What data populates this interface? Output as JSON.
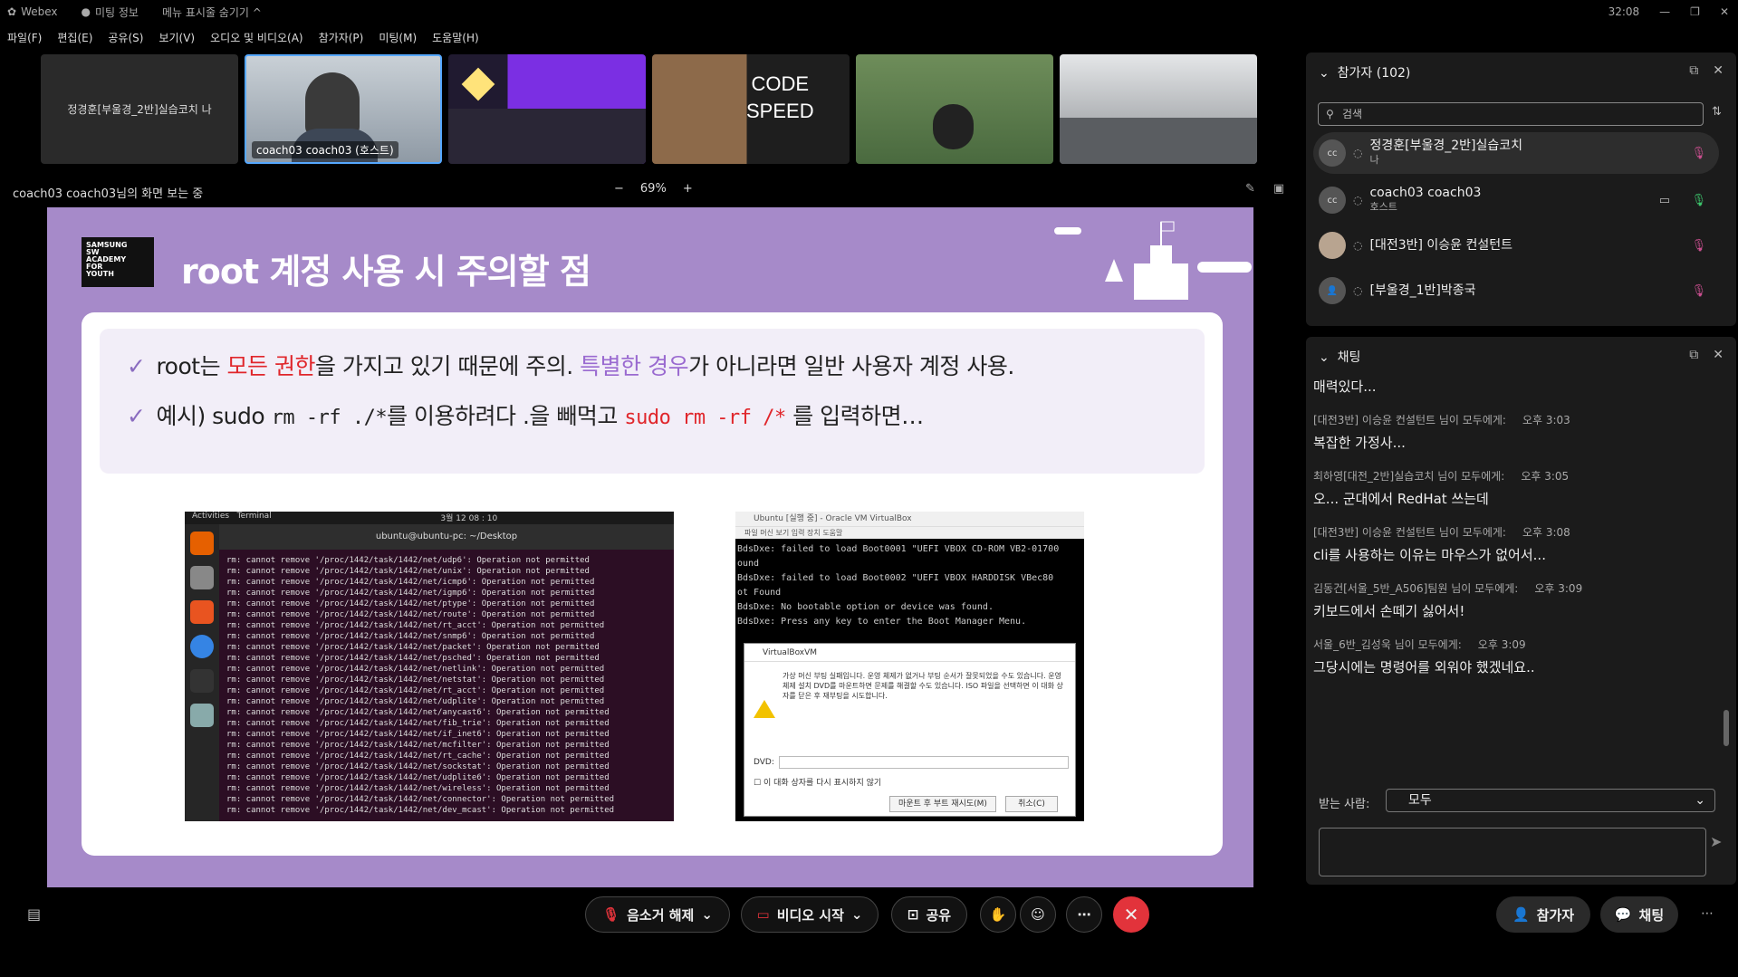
{
  "titlebar": {
    "app": "Webex",
    "meeting_info": "미팅 정보",
    "hide_menu": "메뉴 표시줄 숨기기 ^",
    "time": "32:08"
  },
  "menu": [
    "파일(F)",
    "편집(E)",
    "공유(S)",
    "보기(V)",
    "오디오 및 비디오(A)",
    "참가자(P)",
    "미팅(M)",
    "도움말(H)"
  ],
  "thumbs": {
    "name_tile": "정경훈[부울경_2반]실습코치 나",
    "host_label": "coach03 coach03 (호스트)",
    "code_speed_line1": "CODE",
    "code_speed_line2": "SPEED"
  },
  "share": {
    "viewing": "coach03 coach03님의 화면 보는 중",
    "zoom": "69%",
    "minus": "−",
    "plus": "+"
  },
  "slide": {
    "logo": "SAMSUNG SW ACADEMY FOR YOUTH",
    "title": "root 계정 사용 시 주의할 점",
    "b1_a": "root는 ",
    "b1_red": "모든 권한",
    "b1_b": "을 가지고 있기 때문에 주의. ",
    "b1_purple": "특별한 경우",
    "b1_c": "가 아니라면 일반 사용자 계정 사용.",
    "b2_a": "예시) sudo ",
    "b2_mono1": "rm -rf ./*",
    "b2_b": "를 이용하려다 .을 빼먹고 ",
    "b2_red": "sudo rm -rf /*",
    "b2_c": " 를 입력하면…",
    "term_activities": "Activities",
    "term_app": "Terminal",
    "term_clock": "3월 12 08 : 10",
    "term_title": "ubuntu@ubuntu-pc: ~/Desktop",
    "term_lines": [
      "rm: cannot remove '/proc/1442/task/1442/net/udp6': Operation not permitted",
      "rm: cannot remove '/proc/1442/task/1442/net/unix': Operation not permitted",
      "rm: cannot remove '/proc/1442/task/1442/net/icmp6': Operation not permitted",
      "rm: cannot remove '/proc/1442/task/1442/net/igmp6': Operation not permitted",
      "rm: cannot remove '/proc/1442/task/1442/net/ptype': Operation not permitted",
      "rm: cannot remove '/proc/1442/task/1442/net/route': Operation not permitted",
      "rm: cannot remove '/proc/1442/task/1442/net/rt_acct': Operation not permitted",
      "rm: cannot remove '/proc/1442/task/1442/net/snmp6': Operation not permitted",
      "rm: cannot remove '/proc/1442/task/1442/net/packet': Operation not permitted",
      "rm: cannot remove '/proc/1442/task/1442/net/psched': Operation not permitted",
      "rm: cannot remove '/proc/1442/task/1442/net/netlink': Operation not permitted",
      "rm: cannot remove '/proc/1442/task/1442/net/netstat': Operation not permitted",
      "rm: cannot remove '/proc/1442/task/1442/net/rt_acct': Operation not permitted",
      "rm: cannot remove '/proc/1442/task/1442/net/udplite': Operation not permitted",
      "rm: cannot remove '/proc/1442/task/1442/net/anycast6': Operation not permitted",
      "rm: cannot remove '/proc/1442/task/1442/net/fib_trie': Operation not permitted",
      "rm: cannot remove '/proc/1442/task/1442/net/if_inet6': Operation not permitted",
      "rm: cannot remove '/proc/1442/task/1442/net/mcfilter': Operation not permitted",
      "rm: cannot remove '/proc/1442/task/1442/net/rt_cache': Operation not permitted",
      "rm: cannot remove '/proc/1442/task/1442/net/sockstat': Operation not permitted",
      "rm: cannot remove '/proc/1442/task/1442/net/udplite6': Operation not permitted",
      "rm: cannot remove '/proc/1442/task/1442/net/wireless': Operation not permitted",
      "rm: cannot remove '/proc/1442/task/1442/net/connector': Operation not permitted",
      "rm: cannot remove '/proc/1442/task/1442/net/dev_mcast': Operation not permitted"
    ],
    "vbox_title": "Ubuntu [실행 중] - Oracle VM VirtualBox",
    "vbox_menu": "파일  머신  보기  입력  장치  도움말",
    "vbox_boot": [
      "BdsDxe: failed to load Boot0001 \"UEFI VBOX CD-ROM VB2-01700",
      "ound",
      "BdsDxe: failed to load Boot0002 \"UEFI VBOX HARDDISK VBec80",
      "ot Found",
      "BdsDxe: No bootable option or device was found.",
      "BdsDxe: Press any key to enter the Boot Manager Menu."
    ],
    "dialog_title": "VirtualBoxVM",
    "dialog_msg": "가상 머신 부팅 실패입니다. 운영 체제가 없거나 부팅 순서가 잘못되었을 수도 있습니다. 운영 체제 설치 DVD를 마운트하면 문제를 해결할 수도 있습니다. ISO 파일을 선택하면 이 대화 상자를 닫은 후 재부팅을 시도합니다.",
    "dialog_dvd": "DVD:",
    "dialog_dont_show": "이 대화 상자를 다시 표시하지 않기",
    "dialog_mount": "마운트 후 부트 재시도(M)",
    "dialog_cancel": "취소(C)"
  },
  "participants": {
    "title": "참가자 (102)",
    "search_placeholder": "검색",
    "list": [
      {
        "name": "정경훈[부울경_2반]실습코치",
        "sub": "나",
        "avatar": "cc"
      },
      {
        "name": "coach03 coach03",
        "sub": "호스트",
        "avatar": "cc"
      },
      {
        "name": "[대전3반] 이승윤 컨설턴트",
        "sub": "",
        "avatar": ""
      },
      {
        "name": "[부울경_1반]박종국",
        "sub": "",
        "avatar": ""
      }
    ]
  },
  "chat": {
    "title": "채팅",
    "messages": [
      {
        "meta": "",
        "time": "",
        "text": "매력있다..."
      },
      {
        "meta": "[대전3반] 이승윤 컨설턴트 님이 모두에게:",
        "time": "오후 3:03",
        "text": "복잡한 가정사..."
      },
      {
        "meta": "최하영[대전_2반]실습코치 님이 모두에게:",
        "time": "오후 3:05",
        "text": "오... 군대에서 RedHat 쓰는데"
      },
      {
        "meta": "[대전3반] 이승윤 컨설턴트 님이 모두에게:",
        "time": "오후 3:08",
        "text": "cli를 사용하는 이유는 마우스가 없어서..."
      },
      {
        "meta": "김동건[서울_5반_A506]팀원 님이 모두에게:",
        "time": "오후 3:09",
        "text": "키보드에서 손떼기 싫어서!"
      },
      {
        "meta": "서울_6반_김성욱 님이 모두에게:",
        "time": "오후 3:09",
        "text": "그당시에는 명령어를 외워야 했겠네요.."
      }
    ],
    "recipient_label": "받는 사람:",
    "recipient_value": "모두"
  },
  "controls": {
    "unmute": "음소거 해제",
    "start_video": "비디오 시작",
    "share": "공유",
    "participants": "참가자",
    "chat": "채팅"
  }
}
